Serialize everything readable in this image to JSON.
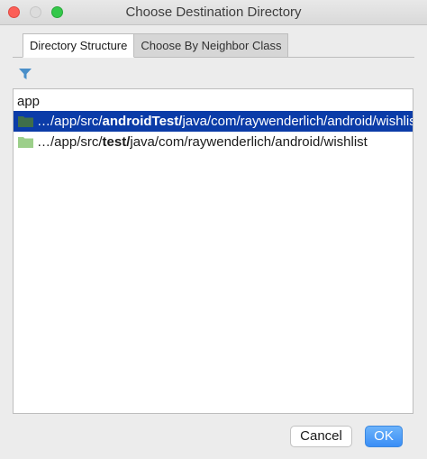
{
  "window": {
    "title": "Choose Destination Directory"
  },
  "tabs": [
    {
      "label": "Directory Structure",
      "active": true
    },
    {
      "label": "Choose By Neighbor Class",
      "active": false
    }
  ],
  "toolbar": {
    "filter_icon": "filter-icon"
  },
  "tree": {
    "root_label": "app",
    "rows": [
      {
        "prefix": "…/app/src/",
        "bold": "androidTest/",
        "suffix": "java/com/raywenderlich/android/wishlist",
        "selected": true,
        "icon": "folder-icon",
        "icon_color": "#3f6e4a"
      },
      {
        "prefix": "…/app/src/",
        "bold": "test/",
        "suffix": "java/com/raywenderlich/android/wishlist",
        "selected": false,
        "icon": "folder-icon",
        "icon_color": "#9ccf8a"
      }
    ]
  },
  "buttons": {
    "cancel_label": "Cancel",
    "ok_label": "OK"
  },
  "colors": {
    "selection": "#0b3ca8",
    "ok_button": "#3a8ef6"
  }
}
